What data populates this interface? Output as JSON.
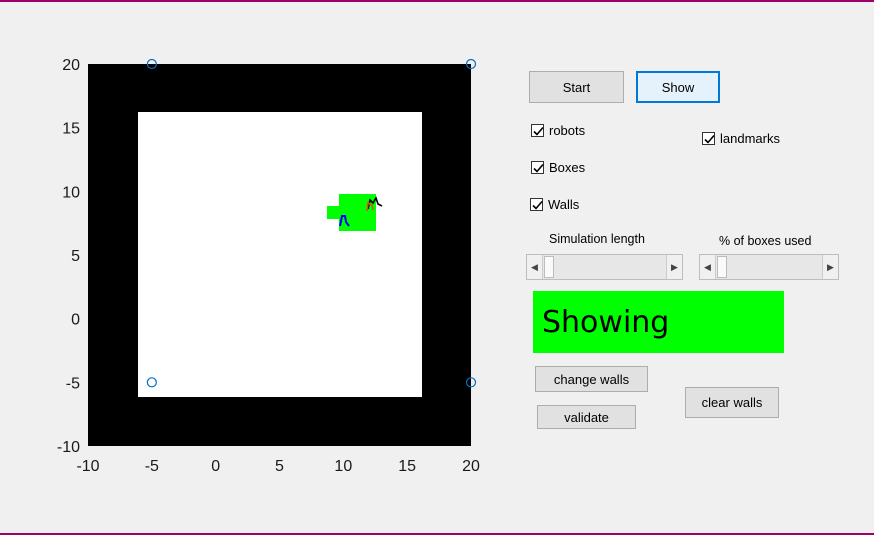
{
  "plot": {
    "x_ticks": [
      "-10",
      "-5",
      "0",
      "5",
      "10",
      "15",
      "20"
    ],
    "y_ticks": [
      "20",
      "15",
      "10",
      "5",
      "0",
      "-5",
      "-10"
    ],
    "x_range": [
      -10,
      20
    ],
    "y_range": [
      -10,
      20
    ],
    "corner_markers": [
      [
        -5,
        20
      ],
      [
        20,
        20
      ],
      [
        -5,
        -5
      ],
      [
        20,
        -5
      ]
    ],
    "colors": {
      "wall": "#000000",
      "arena": "#ffffff",
      "boxes": "#00ff00",
      "marker": "#0072bd",
      "robot_blue": "#0000ff",
      "robot_orange": "#d95319"
    }
  },
  "controls": {
    "start_label": "Start",
    "show_label": "Show",
    "robots_label": "robots",
    "landmarks_label": "landmarks",
    "boxes_label": "Boxes",
    "walls_label": "Walls",
    "sim_length_label": "Simulation length",
    "pct_boxes_label": "% of boxes used",
    "change_walls_label": "change walls",
    "validate_label": "validate",
    "clear_walls_label": "clear walls"
  },
  "checkboxes": {
    "robots": true,
    "landmarks": true,
    "boxes": true,
    "walls": true
  },
  "sliders": {
    "simulation_length": 0,
    "pct_boxes_used": 0
  },
  "status": {
    "text": "Showing",
    "color": "#00ff00"
  }
}
